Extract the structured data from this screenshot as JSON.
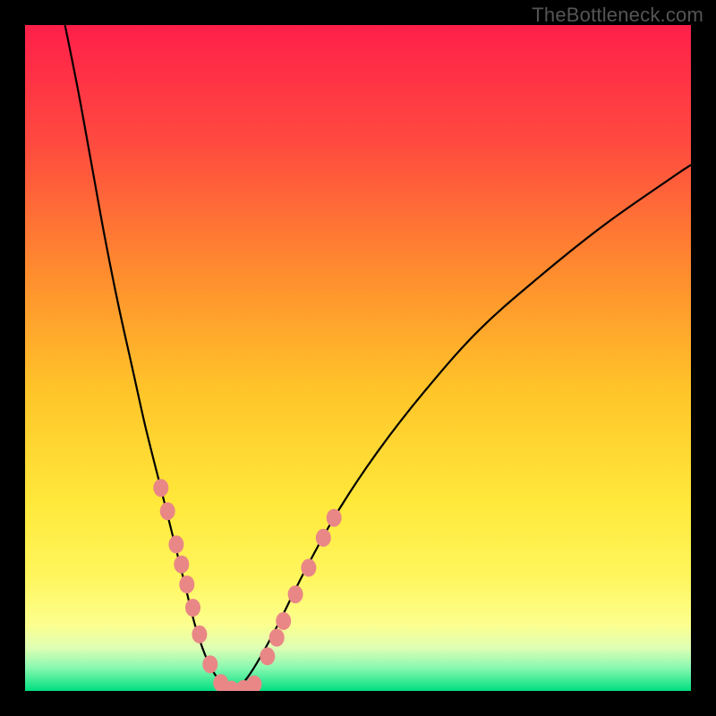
{
  "watermark": "TheBottleneck.com",
  "colors": {
    "frame": "#000000",
    "gradient_stops": [
      {
        "offset": 0.0,
        "color": "#ff1f4a"
      },
      {
        "offset": 0.18,
        "color": "#ff4b3f"
      },
      {
        "offset": 0.38,
        "color": "#ff8f2e"
      },
      {
        "offset": 0.55,
        "color": "#ffc529"
      },
      {
        "offset": 0.72,
        "color": "#ffe93b"
      },
      {
        "offset": 0.83,
        "color": "#fff65e"
      },
      {
        "offset": 0.9,
        "color": "#fcff8e"
      },
      {
        "offset": 0.935,
        "color": "#dfffb4"
      },
      {
        "offset": 0.965,
        "color": "#89f9b0"
      },
      {
        "offset": 1.0,
        "color": "#00de80"
      }
    ],
    "curve": "#000000",
    "dots": "#e98787"
  },
  "chart_data": {
    "type": "line",
    "title": "",
    "xlabel": "",
    "ylabel": "",
    "xlim": [
      0,
      100
    ],
    "ylim": [
      0,
      100
    ],
    "grid": false,
    "legend": false,
    "note": "Two V-shaped bottleneck curves on a red→green vertical performance gradient; y=0 is ideal (green). Values are read off pixel positions (no numeric axes shown).",
    "series": [
      {
        "name": "curve-left",
        "x": [
          6,
          8,
          10,
          12,
          14,
          16,
          18,
          20,
          22,
          24,
          25.5,
          27,
          28.5,
          30,
          31.3
        ],
        "y": [
          100,
          90,
          79,
          68,
          58,
          49,
          40,
          32,
          24,
          16,
          10,
          5.5,
          2.5,
          0.8,
          0
        ]
      },
      {
        "name": "curve-right",
        "x": [
          31.3,
          33,
          35,
          38,
          42,
          47,
          53,
          60,
          68,
          77,
          87,
          97,
          100
        ],
        "y": [
          0,
          1.5,
          4.5,
          10,
          18,
          27,
          36,
          45,
          54,
          62,
          70,
          77,
          79
        ]
      }
    ],
    "dots_left": [
      {
        "x": 20.4,
        "y": 30.5
      },
      {
        "x": 21.4,
        "y": 27.0
      },
      {
        "x": 22.7,
        "y": 22.0
      },
      {
        "x": 23.5,
        "y": 19.0
      },
      {
        "x": 24.3,
        "y": 16.0
      },
      {
        "x": 25.2,
        "y": 12.5
      },
      {
        "x": 26.2,
        "y": 8.5
      },
      {
        "x": 27.8,
        "y": 4.0
      },
      {
        "x": 29.4,
        "y": 1.2
      },
      {
        "x": 31.0,
        "y": 0.2
      },
      {
        "x": 32.8,
        "y": 0.3
      },
      {
        "x": 34.4,
        "y": 1.0
      }
    ],
    "dots_right": [
      {
        "x": 36.4,
        "y": 5.2
      },
      {
        "x": 37.8,
        "y": 8.0
      },
      {
        "x": 38.8,
        "y": 10.5
      },
      {
        "x": 40.6,
        "y": 14.5
      },
      {
        "x": 42.6,
        "y": 18.5
      },
      {
        "x": 44.8,
        "y": 23.0
      },
      {
        "x": 46.4,
        "y": 26.0
      }
    ]
  }
}
